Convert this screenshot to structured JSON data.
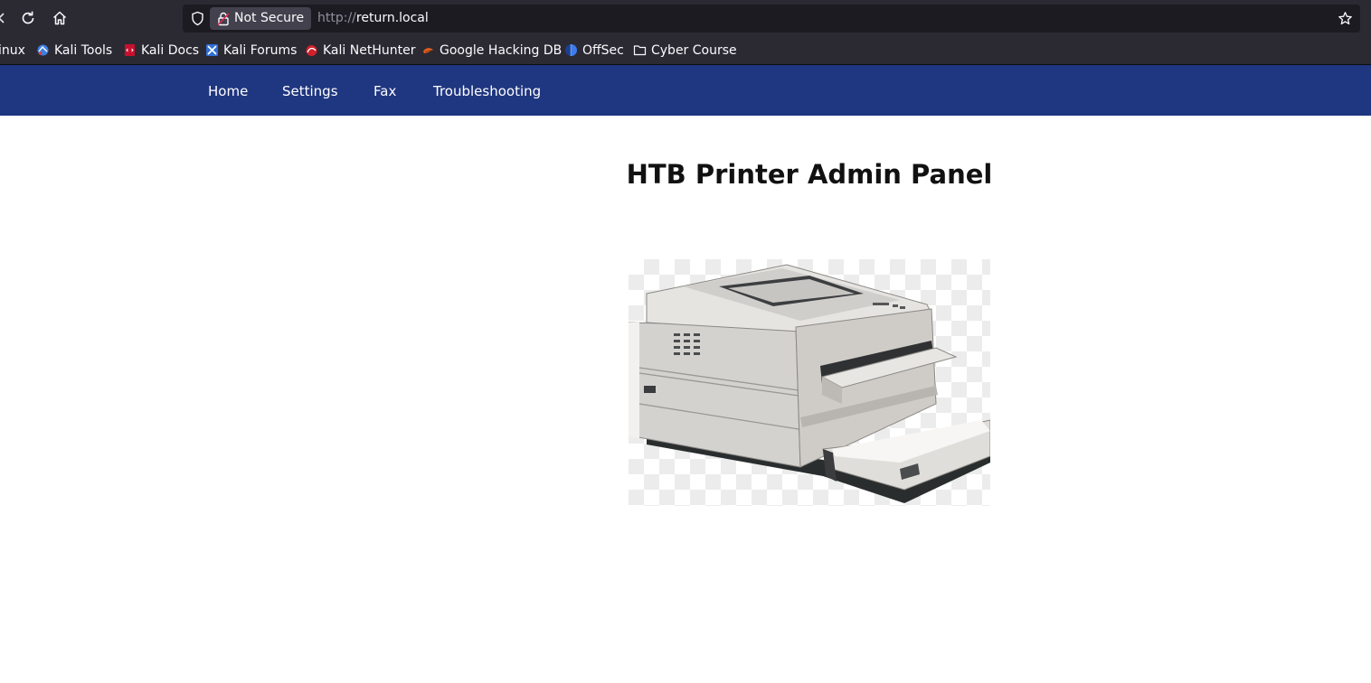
{
  "browser": {
    "security_label": "Not Secure",
    "url_protocol": "http://",
    "url_host": "return.local",
    "bookmarks": [
      {
        "label": "inux",
        "icon": "kali-linux-icon"
      },
      {
        "label": "Kali Tools",
        "icon": "kali-tools-icon"
      },
      {
        "label": "Kali Docs",
        "icon": "kali-docs-icon"
      },
      {
        "label": "Kali Forums",
        "icon": "kali-forums-icon"
      },
      {
        "label": "Kali NetHunter",
        "icon": "kali-nethunter-icon"
      },
      {
        "label": "Google Hacking DB",
        "icon": "exploit-db-icon"
      },
      {
        "label": "OffSec",
        "icon": "offsec-icon"
      },
      {
        "label": "Cyber Course",
        "icon": "folder-icon"
      }
    ]
  },
  "nav": {
    "items": [
      {
        "label": "Home"
      },
      {
        "label": "Settings"
      },
      {
        "label": "Fax"
      },
      {
        "label": "Troubleshooting"
      }
    ]
  },
  "main": {
    "title": "HTB Printer Admin Panel",
    "image_icon": "printer-icon"
  },
  "colors": {
    "toolbar_bg": "#2b2a33",
    "urlbar_bg": "#1c1b22",
    "nav_bg": "#1f3680",
    "page_bg": "#ffffff"
  }
}
